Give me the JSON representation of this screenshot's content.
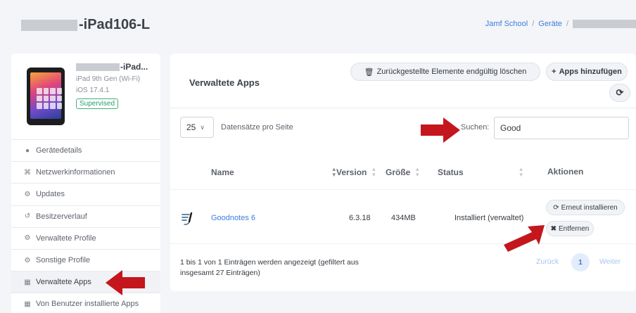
{
  "header": {
    "device_title_suffix": "-iPad106-L",
    "breadcrumb": [
      {
        "label": "Jamf School"
      },
      {
        "label": "Geräte"
      }
    ]
  },
  "device": {
    "name_suffix": "-iPad...",
    "model": "iPad 9th Gen (Wi-Fi)",
    "os": "iOS 17.4.1",
    "badge": "Supervised"
  },
  "sidebar": {
    "items": [
      {
        "label": "Gerätedetails",
        "icon": "apple-icon"
      },
      {
        "label": "Netzwerkinformationen",
        "icon": "network-icon"
      },
      {
        "label": "Updates",
        "icon": "gears-icon"
      },
      {
        "label": "Besitzerverlauf",
        "icon": "history-icon"
      },
      {
        "label": "Verwaltete Profile",
        "icon": "gears-icon"
      },
      {
        "label": "Sonstige Profile",
        "icon": "gears-icon"
      },
      {
        "label": "Verwaltete Apps",
        "icon": "apps-icon"
      },
      {
        "label": "Von Benutzer installierte Apps",
        "icon": "apps-icon"
      }
    ],
    "active_index": 6
  },
  "main": {
    "title": "Verwaltete Apps",
    "delete_button": "Zurückgestellte Elemente endgültig löschen",
    "add_button": "Apps hinzufügen",
    "page_size": "25",
    "per_page_label": "Datensätze pro Seite",
    "search_label": "Suchen:",
    "search_value": "Good",
    "columns": [
      "Name",
      "Version",
      "Größe",
      "Status",
      "Aktionen"
    ],
    "rows": [
      {
        "name": "Goodnotes 6",
        "version": "6.3.18",
        "size": "434MB",
        "status": "Installiert (verwaltet)",
        "reinstall_label": "Erneut installieren",
        "remove_label": "Entfernen"
      }
    ],
    "info_text": "1 bis 1 von 1 Einträgen werden angezeigt (gefiltert aus insgesamt 27 Einträgen)",
    "pager": {
      "prev": "Zurück",
      "page": "1",
      "next": "Weiter"
    }
  },
  "colors": {
    "accent": "#3b7ddd",
    "annotation_arrow": "#c4161c",
    "supervised_badge": "#2b9d69"
  }
}
